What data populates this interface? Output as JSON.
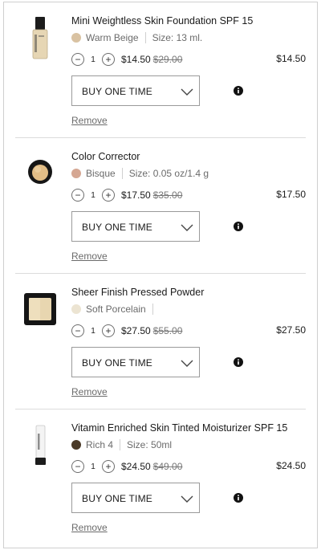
{
  "cart": {
    "items": [
      {
        "name": "Mini Weightless Skin Foundation SPF 15",
        "shade_color": "#d9c2a2",
        "shade": "Warm Beige",
        "size": "Size: 13 ml.",
        "qty": "1",
        "price": "$14.50",
        "original_price": "$29.00",
        "total": "$14.50",
        "purchase_option": "BUY ONE TIME",
        "remove_label": "Remove",
        "thumb_icon": "foundation-bottle-icon"
      },
      {
        "name": "Color Corrector",
        "shade_color": "#d5a793",
        "shade": "Bisque",
        "size": "Size: 0.05 oz/1.4 g",
        "qty": "1",
        "price": "$17.50",
        "original_price": "$35.00",
        "total": "$17.50",
        "purchase_option": "BUY ONE TIME",
        "remove_label": "Remove",
        "thumb_icon": "corrector-pot-icon"
      },
      {
        "name": "Sheer Finish Pressed Powder",
        "shade_color": "#ece4d2",
        "shade": "Soft Porcelain",
        "size": "",
        "qty": "1",
        "price": "$27.50",
        "original_price": "$55.00",
        "total": "$27.50",
        "purchase_option": "BUY ONE TIME",
        "remove_label": "Remove",
        "thumb_icon": "powder-compact-icon"
      },
      {
        "name": "Vitamin Enriched Skin Tinted Moisturizer SPF 15",
        "shade_color": "#4a3a28",
        "shade": "Rich 4",
        "size": "Size: 50ml",
        "qty": "1",
        "price": "$24.50",
        "original_price": "$49.00",
        "total": "$24.50",
        "purchase_option": "BUY ONE TIME",
        "remove_label": "Remove",
        "thumb_icon": "moisturizer-tube-icon"
      }
    ]
  }
}
